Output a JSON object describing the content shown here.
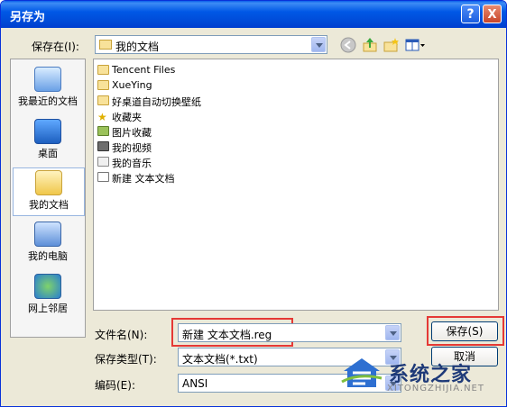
{
  "window": {
    "title": "另存为",
    "help_symbol": "?",
    "close_symbol": "X"
  },
  "toolbar": {
    "save_in_label": "保存在(I):",
    "location": "我的文档",
    "icons": [
      "back-icon",
      "up-folder-icon",
      "new-folder-icon",
      "view-menu-icon"
    ]
  },
  "places": [
    {
      "label": "我最近的文档",
      "icon": "recent-documents-icon"
    },
    {
      "label": "桌面",
      "icon": "desktop-icon"
    },
    {
      "label": "我的文档",
      "icon": "my-documents-icon",
      "selected": true
    },
    {
      "label": "我的电脑",
      "icon": "my-computer-icon"
    },
    {
      "label": "网上邻居",
      "icon": "network-places-icon"
    }
  ],
  "files": [
    {
      "name": "Tencent Files",
      "type": "folder"
    },
    {
      "name": "XueYing",
      "type": "folder"
    },
    {
      "name": "好桌道自动切换壁纸",
      "type": "folder"
    },
    {
      "name": "收藏夹",
      "type": "favorites"
    },
    {
      "name": "图片收藏",
      "type": "pictures"
    },
    {
      "name": "我的视频",
      "type": "videos"
    },
    {
      "name": "我的音乐",
      "type": "music"
    },
    {
      "name": "新建 文本文档",
      "type": "text-document"
    }
  ],
  "form": {
    "filename_label": "文件名(N):",
    "filename_value": "新建 文本文档.reg",
    "filetype_label": "保存类型(T):",
    "filetype_value": "文本文档(*.txt)",
    "encoding_label": "编码(E):",
    "encoding_value": "ANSI"
  },
  "buttons": {
    "save": "保存(S)",
    "cancel": "取消"
  },
  "watermark": {
    "title": "系统之家",
    "subtitle": "XITONGZHIJIA.NET"
  },
  "colors": {
    "titlebar": "#0058e6",
    "highlight_box": "#e53935",
    "dialog_bg": "#ece9d8"
  }
}
